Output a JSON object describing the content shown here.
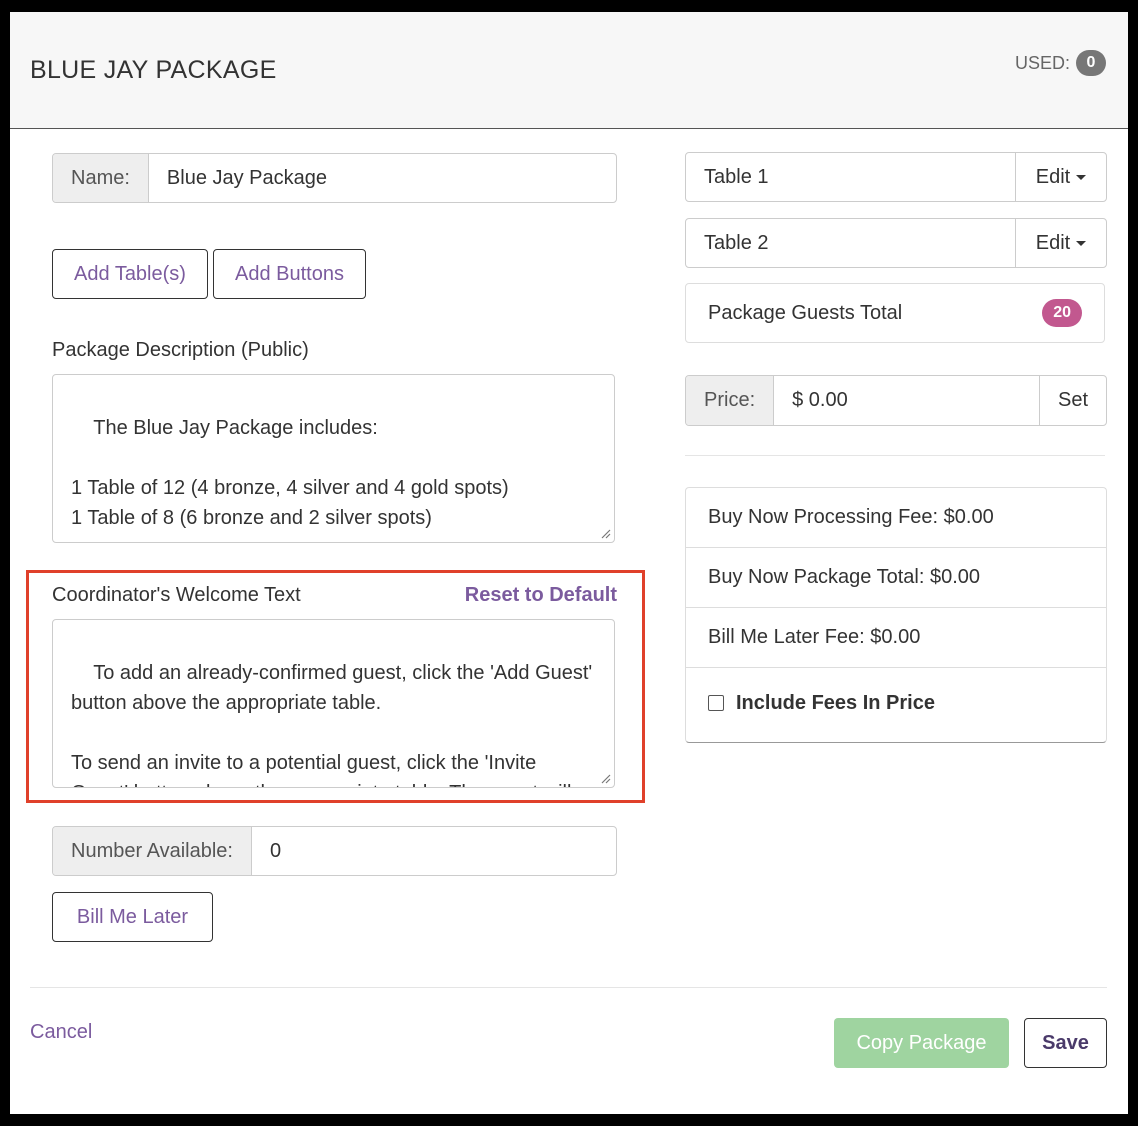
{
  "header": {
    "title": "BLUE JAY PACKAGE",
    "used_label": "USED:",
    "used_count": "0"
  },
  "name_field": {
    "label": "Name:",
    "value": "Blue Jay Package"
  },
  "buttons": {
    "add_tables": "Add Table(s)",
    "add_buttons": "Add Buttons",
    "bill_me_later": "Bill Me Later",
    "cancel": "Cancel",
    "copy_package": "Copy Package",
    "save": "Save"
  },
  "description": {
    "label": "Package Description (Public)",
    "value": "The Blue Jay Package includes:\n\n1 Table of 12 (4 bronze, 4 silver and 4 gold spots)\n1 Table of 8 (6 bronze and 2 silver spots)"
  },
  "welcome": {
    "label": "Coordinator's Welcome Text",
    "reset_label": "Reset to Default",
    "value": "To add an already-confirmed guest, click the 'Add Guest' button above the appropriate table.\n\nTo send an invite to a potential guest, click the 'Invite Guest' button above the appropriate table. The guest will receive an invite email from you containing a custom link"
  },
  "number_available": {
    "label": "Number Available:",
    "value": "0"
  },
  "tables": [
    {
      "name": "Table 1",
      "edit_label": "Edit"
    },
    {
      "name": "Table 2",
      "edit_label": "Edit"
    }
  ],
  "guests_total": {
    "label": "Package Guests Total",
    "count": "20"
  },
  "price": {
    "label": "Price:",
    "value": "$ 0.00",
    "set_label": "Set"
  },
  "fees": {
    "processing_fee": "Buy Now Processing Fee: $0.00",
    "package_total": "Buy Now Package Total: $0.00",
    "bill_later_fee": "Bill Me Later Fee: $0.00",
    "include_fees_label": "Include Fees In Price"
  },
  "colors": {
    "accent": "#7b5b9e",
    "badge": "#c2588f",
    "copy_button": "#9fd4a0",
    "highlight": "#e0402a"
  }
}
